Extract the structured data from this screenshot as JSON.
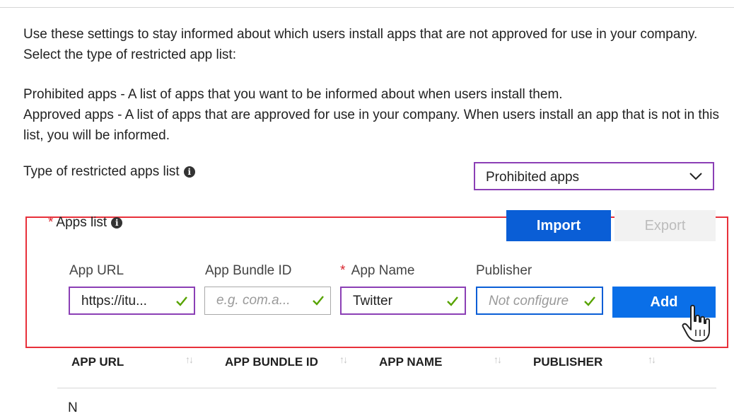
{
  "intro": {
    "paragraph1": "Use these settings to stay informed about which users install apps that are not approved for use in your company. Select the type of restricted app list:",
    "prohibited_line": "Prohibited apps - A list of apps that you want to be informed about when users install them.",
    "approved_line": "Approved apps - A list of apps that are approved for use in your company. When users install an app that is not in this list, you will be informed."
  },
  "restricted_type": {
    "label": "Type of restricted apps list",
    "selected": "Prohibited apps"
  },
  "apps_list": {
    "required_mark": "*",
    "label": "Apps list",
    "import_label": "Import",
    "export_label": "Export",
    "columns": {
      "app_url": "App URL",
      "app_bundle_id": "App Bundle ID",
      "app_name": "App Name",
      "publisher": "Publisher"
    },
    "inputs": {
      "app_url_value": "https://itu...",
      "app_bundle_id_placeholder": "e.g. com.a...",
      "app_name_value": "Twitter",
      "publisher_placeholder": "Not configure"
    },
    "add_label": "Add"
  },
  "table": {
    "headers": [
      "APP URL",
      "APP BUNDLE ID",
      "APP NAME",
      "PUBLISHER"
    ],
    "sort_glyph": "↑↓"
  },
  "bottom_cutoff_text": "N",
  "colors": {
    "accent_blue": "#0a5ed6",
    "purple_border": "#8b3fb5",
    "highlight_red": "#e8303a",
    "check_green": "#57a300"
  },
  "icons": [
    "info-icon",
    "chevron-down-icon",
    "checkmark-icon",
    "hand-pointer-cursor-icon",
    "sort-icon"
  ]
}
